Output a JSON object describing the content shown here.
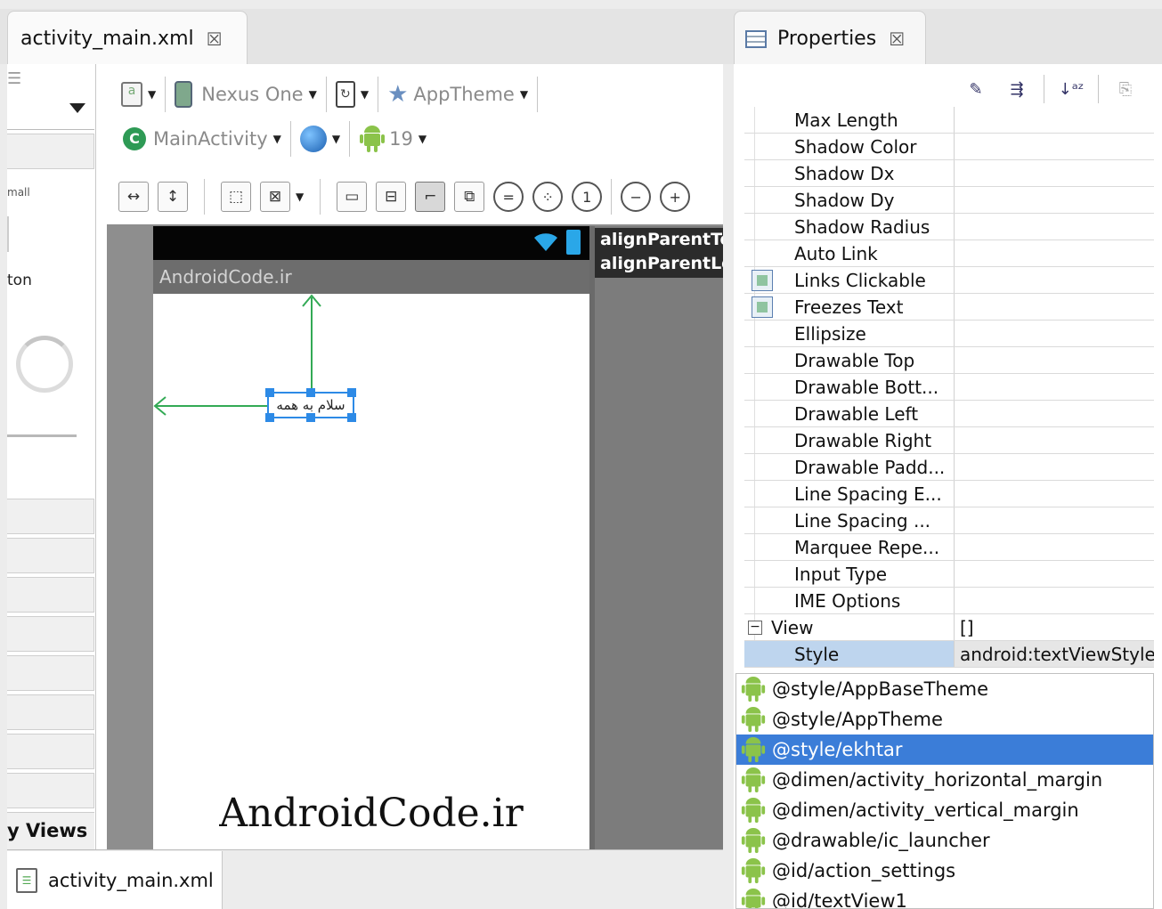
{
  "editor": {
    "tab_title": "activity_main.xml",
    "bottom_tab": "activity_main.xml",
    "palette": {
      "texts": [
        "mall",
        "ton",
        "y Views"
      ]
    },
    "toolbar": {
      "device": "Nexus One",
      "theme": "AppTheme",
      "activity": "MainActivity",
      "api_level": "19"
    },
    "canvas": {
      "app_title": "AndroidCode.ir",
      "textview_text": "سلام به همه",
      "hint_lines": [
        "alignParentTop",
        "alignParentLeft"
      ],
      "watermark": "AndroidCode.ir"
    }
  },
  "properties": {
    "tab_title": "Properties",
    "rows": [
      {
        "name": "Max Length",
        "value": ""
      },
      {
        "name": "Shadow Color",
        "value": ""
      },
      {
        "name": "Shadow Dx",
        "value": ""
      },
      {
        "name": "Shadow Dy",
        "value": ""
      },
      {
        "name": "Shadow Radius",
        "value": ""
      },
      {
        "name": "Auto Link",
        "value": ""
      },
      {
        "name": "Links Clickable",
        "value": "",
        "checkbox": true
      },
      {
        "name": "Freezes Text",
        "value": "",
        "checkbox": true
      },
      {
        "name": "Ellipsize",
        "value": ""
      },
      {
        "name": "Drawable Top",
        "value": ""
      },
      {
        "name": "Drawable Bott...",
        "value": ""
      },
      {
        "name": "Drawable Left",
        "value": ""
      },
      {
        "name": "Drawable Right",
        "value": ""
      },
      {
        "name": "Drawable Padd...",
        "value": ""
      },
      {
        "name": "Line Spacing E...",
        "value": ""
      },
      {
        "name": "Line Spacing ...",
        "value": ""
      },
      {
        "name": "Marquee Repe...",
        "value": ""
      },
      {
        "name": "Input Type",
        "value": ""
      },
      {
        "name": "IME Options",
        "value": ""
      }
    ],
    "group": {
      "name": "View",
      "value": "[]",
      "expander": "−"
    },
    "style_row": {
      "name": "Style",
      "value": "android:textViewStyle"
    },
    "dropdown": [
      "@style/AppBaseTheme",
      "@style/AppTheme",
      "@style/ekhtar",
      "@dimen/activity_horizontal_margin",
      "@dimen/activity_vertical_margin",
      "@drawable/ic_launcher",
      "@id/action_settings",
      "@id/textView1"
    ],
    "dropdown_selected": "@style/ekhtar"
  },
  "colors": {
    "selection": "#3b7dd8",
    "style_row": "#bed5ee",
    "guide_green": "#33aa55",
    "handle_blue": "#2d8ae6",
    "android_green": "#8bc34a"
  }
}
